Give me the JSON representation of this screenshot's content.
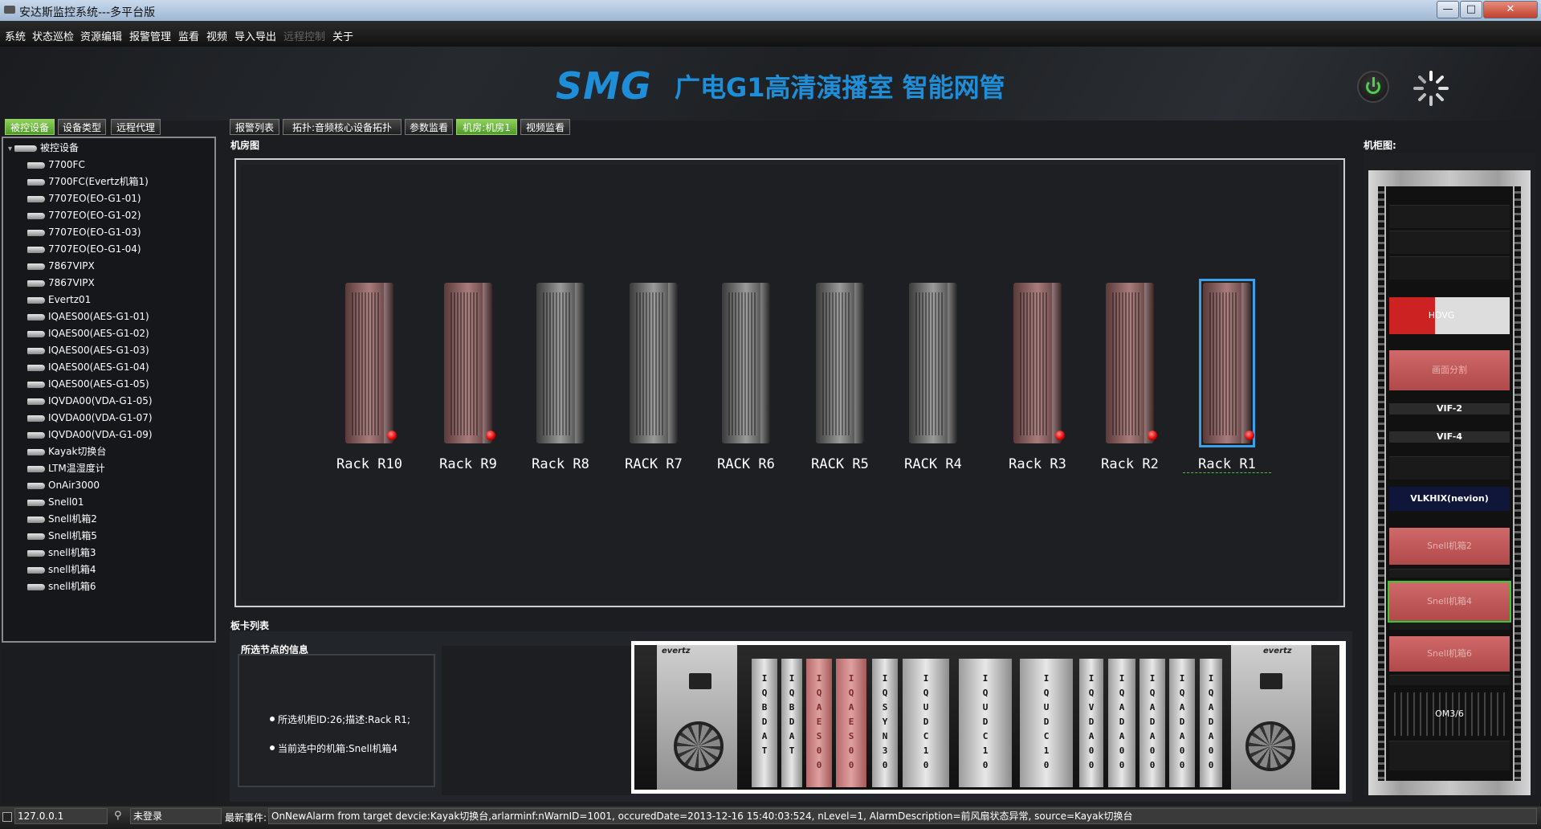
{
  "window": {
    "title": "安达斯监控系统---多平台版",
    "minimize": "—",
    "maximize": "□",
    "close": "✕"
  },
  "menu": [
    "系统",
    "状态巡检",
    "资源编辑",
    "报警管理",
    "监看",
    "视频",
    "导入导出",
    "远程控制",
    "关于"
  ],
  "menu_disabled": [
    false,
    false,
    false,
    false,
    false,
    false,
    false,
    true,
    false
  ],
  "header": {
    "logo": "SMG",
    "title": "广电G1高清演播室 智能网管"
  },
  "left_tabs": [
    "被控设备",
    "设备类型",
    "远程代理"
  ],
  "main_tabs": [
    "报警列表",
    "拓扑:音频核心设备拓扑",
    "参数监看",
    "机房:机房1",
    "视频监看"
  ],
  "tree": {
    "root": "被控设备",
    "items": [
      "7700FC",
      "7700FC(Evertz机箱1)",
      "7707EO(EO-G1-01)",
      "7707EO(EO-G1-02)",
      "7707EO(EO-G1-03)",
      "7707EO(EO-G1-04)",
      "7867VIPX",
      "7867VIPX",
      "Evertz01",
      "IQAES00(AES-G1-01)",
      "IQAES00(AES-G1-02)",
      "IQAES00(AES-G1-03)",
      "IQAES00(AES-G1-04)",
      "IQAES00(AES-G1-05)",
      "IQVDA00(VDA-G1-05)",
      "IQVDA00(VDA-G1-07)",
      "IQVDA00(VDA-G1-09)",
      "Kayak切换台",
      "LTM温湿度计",
      "OnAir3000",
      "Snell01",
      "Snell机箱2",
      "Snell机箱5",
      "snell机箱3",
      "snell机箱4",
      "snell机箱6"
    ]
  },
  "room": {
    "label": "机房图",
    "racks": [
      {
        "name": "Rack R10",
        "color": "red",
        "alarm": true
      },
      {
        "name": "Rack R9",
        "color": "red",
        "alarm": true
      },
      {
        "name": "Rack R8",
        "color": "gray",
        "alarm": false
      },
      {
        "name": "RACK R7",
        "color": "gray",
        "alarm": false
      },
      {
        "name": "RACK R6",
        "color": "gray",
        "alarm": false
      },
      {
        "name": "RACK R5",
        "color": "gray",
        "alarm": false
      },
      {
        "name": "RACK R4",
        "color": "gray",
        "alarm": false
      },
      {
        "name": "Rack R3",
        "color": "red",
        "alarm": true
      },
      {
        "name": "Rack R2",
        "color": "red",
        "alarm": true
      },
      {
        "name": "Rack R1",
        "color": "red",
        "alarm": true,
        "selected": true
      }
    ]
  },
  "cards": {
    "label": "板卡列表",
    "info_title": "所选节点的信息",
    "info_lines": [
      "所选机柜ID:26;描述:Rack R1;",
      "当前选中的机箱:Snell机箱4"
    ],
    "brand": "evertz",
    "slots": [
      {
        "text": "IQBDAT",
        "color": "g"
      },
      {
        "text": "IQBDAT",
        "color": "g"
      },
      {
        "text": "IQAES00",
        "color": "r"
      },
      {
        "text": "IQAES00",
        "color": "r"
      },
      {
        "text": "IQSYN30",
        "color": "g"
      },
      {
        "text": "IQUDC10",
        "color": "g"
      },
      {
        "text": "IQUDC10",
        "color": "g"
      },
      {
        "text": "IQUDC10",
        "color": "g"
      },
      {
        "text": "IQVDA00",
        "color": "g"
      },
      {
        "text": "IQADA00",
        "color": "g"
      },
      {
        "text": "IQADA00",
        "color": "g"
      },
      {
        "text": "IQADA00",
        "color": "g"
      },
      {
        "text": "IQADA00",
        "color": "g"
      }
    ]
  },
  "cabinet": {
    "label": "机柜图:",
    "devices": [
      "HDVG",
      "画面分割",
      "VIF-2",
      "VIF-4",
      "VLKHIX(nevion)",
      "Snell机箱2",
      "Snell机箱4",
      "Snell机箱6",
      "OM3/6"
    ]
  },
  "status": {
    "ip": "127.0.0.1",
    "login": "未登录",
    "event_label": "最新事件:",
    "event": "OnNewAlarm from target devcie:Kayak切换台,arlarminf:nWarnID=1001, occuredDate=2013-12-16 15:40:03:524, nLevel=1, AlarmDescription=前风扇状态异常, source=Kayak切换台"
  },
  "colors": {
    "accent": "#1e8ed8",
    "active_tab": "#6cb83a",
    "alarm": "#dd0000"
  }
}
